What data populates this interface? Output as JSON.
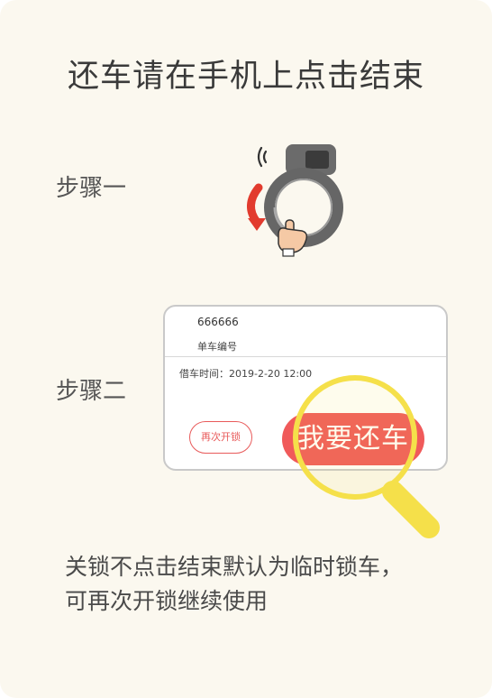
{
  "title": "还车请在手机上点击结束",
  "steps": [
    {
      "label": "步骤一"
    },
    {
      "label": "步骤二"
    }
  ],
  "phone_card": {
    "bike_number": "666666",
    "bike_number_label": "单车编号",
    "borrow_time": "借车时间：2019-2-20 12:00",
    "unlock_again_label": "再次开锁",
    "return_label": "我要还车"
  },
  "note_lines": [
    "关锁不点击结束默认为临时锁车，",
    "可再次开锁继续使用"
  ],
  "colors": {
    "background": "#fbf8ef",
    "accent_red": "#f05a5a",
    "magnifier_yellow": "#f5e04a"
  },
  "icons": {
    "lock": "ring-lock-icon",
    "arrow": "rotate-arrow-icon",
    "hand": "hand-icon",
    "signal": "sound-waves-icon",
    "magnifier": "magnifier-icon"
  }
}
